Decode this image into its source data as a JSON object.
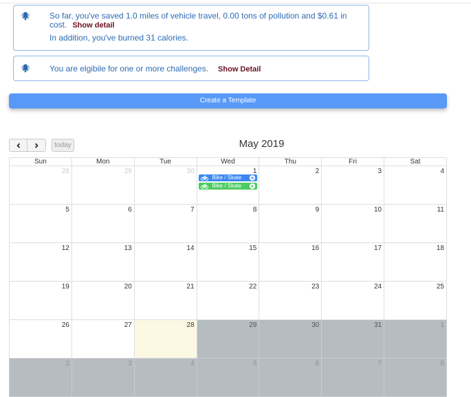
{
  "alerts": {
    "savings": {
      "line1": "So far, you've saved 1.0 miles of vehicle travel, 0.00 tons of pollution and $0.61 in",
      "line2": "cost.",
      "show_label": "Show detail",
      "line3": "In addition, you've burned 31 calories."
    },
    "challenges": {
      "text": "You are elgibile for one or more challenges.",
      "show_label": "Show Detail"
    }
  },
  "create_button": "Create a Template",
  "calendar": {
    "title": "May 2019",
    "today_label": "today",
    "weekdays": [
      "Sun",
      "Mon",
      "Tue",
      "Wed",
      "Thu",
      "Fri",
      "Sat"
    ],
    "weeks": [
      [
        "28",
        "29",
        "30",
        "1",
        "2",
        "3",
        "4"
      ],
      [
        "5",
        "6",
        "7",
        "8",
        "9",
        "10",
        "11"
      ],
      [
        "12",
        "13",
        "14",
        "15",
        "16",
        "17",
        "18"
      ],
      [
        "19",
        "20",
        "21",
        "22",
        "23",
        "24",
        "25"
      ],
      [
        "26",
        "27",
        "28",
        "29",
        "30",
        "31",
        "1"
      ],
      [
        "2",
        "3",
        "4",
        "5",
        "6",
        "7",
        "8"
      ]
    ],
    "events": [
      {
        "label": "Bike / Skate",
        "color": "#3b88f1"
      },
      {
        "label": "Bike / Skate",
        "color": "#4ccb62"
      }
    ]
  },
  "colors": {
    "accent": "#5899f7",
    "alert_text": "#2e6ab3",
    "link": "#6b1020",
    "today_bg": "#fcf8e3",
    "future_bg": "#b6bcc0"
  },
  "icons": {
    "alert": "bell-icon",
    "prev": "chevron-left-icon",
    "next": "chevron-right-icon",
    "event": "bicycle-icon",
    "remove": "close-circle-icon"
  }
}
